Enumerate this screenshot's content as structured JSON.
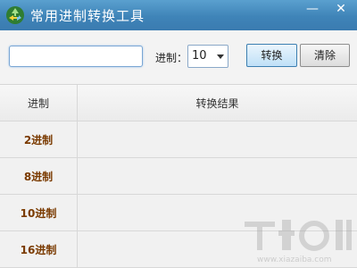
{
  "window": {
    "title": "常用进制转换工具",
    "minimize_glyph": "—",
    "close_glyph": "✕",
    "app_icon": "recycle-leaf-icon"
  },
  "toolbar": {
    "value_input": {
      "value": "",
      "placeholder": ""
    },
    "base_label": "进制：",
    "base_select": {
      "selected": "10"
    },
    "convert_label": "转换",
    "clear_label": "清除"
  },
  "grid": {
    "headers": {
      "base": "进制",
      "result": "转换结果"
    },
    "rows": [
      {
        "base": "2进制",
        "result": ""
      },
      {
        "base": "8进制",
        "result": ""
      },
      {
        "base": "10进制",
        "result": ""
      },
      {
        "base": "16进制",
        "result": ""
      }
    ]
  },
  "watermark": {
    "url": "www.xiazaiba.com"
  },
  "colors": {
    "titlebar": "#4a8fc3",
    "accent_text": "#7a3a00",
    "convert_button": "#bfe0f7"
  }
}
